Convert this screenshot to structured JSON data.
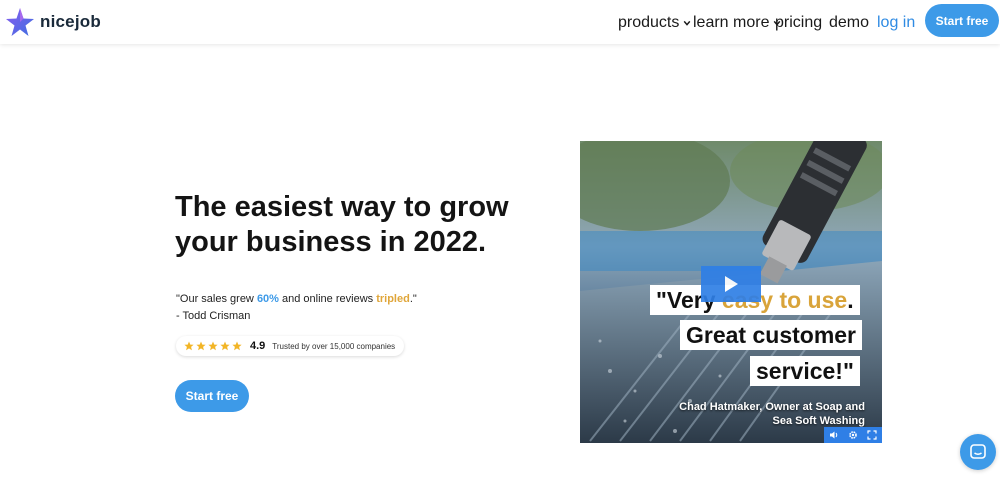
{
  "brand": {
    "name": "nicejob"
  },
  "nav": {
    "items": [
      {
        "label": "products",
        "dropdown": true
      },
      {
        "label": "learn more",
        "dropdown": true
      },
      {
        "label": "pricing",
        "dropdown": false
      },
      {
        "label": "demo",
        "dropdown": false
      }
    ],
    "login_label": "log in",
    "cta_label": "Start free"
  },
  "hero": {
    "headline_line1": "The easiest way to grow",
    "headline_line2": "your business in 2022.",
    "quote_prefix": "\"Our sales grew ",
    "quote_highlight1": "60%",
    "quote_middle": " and online reviews ",
    "quote_highlight2": "tripled",
    "quote_suffix": ".\"",
    "quote_author": "- Todd Crisman",
    "rating_value": "4.9",
    "rating_stars": 5,
    "rating_text": "Trusted by over 15,000 companies",
    "cta_label": "Start free"
  },
  "video": {
    "caption_line1_a": "\"Very ",
    "caption_line1_b": "easy to use",
    "caption_line1_c": ".",
    "caption_line2": "Great customer",
    "caption_line3": "service!\"",
    "attribution": "Chad Hatmaker, Owner at Soap and Sea Soft Washing"
  },
  "colors": {
    "accent": "#3d9ae8",
    "highlight_gold": "#e0a63a",
    "star": "#f2b526"
  },
  "icons": {
    "logo": "star-logo-icon",
    "dropdown": "chevron-down-icon",
    "play": "play-icon",
    "volume": "volume-icon",
    "settings": "gear-icon",
    "fullscreen": "fullscreen-icon",
    "chat": "chat-icon"
  }
}
